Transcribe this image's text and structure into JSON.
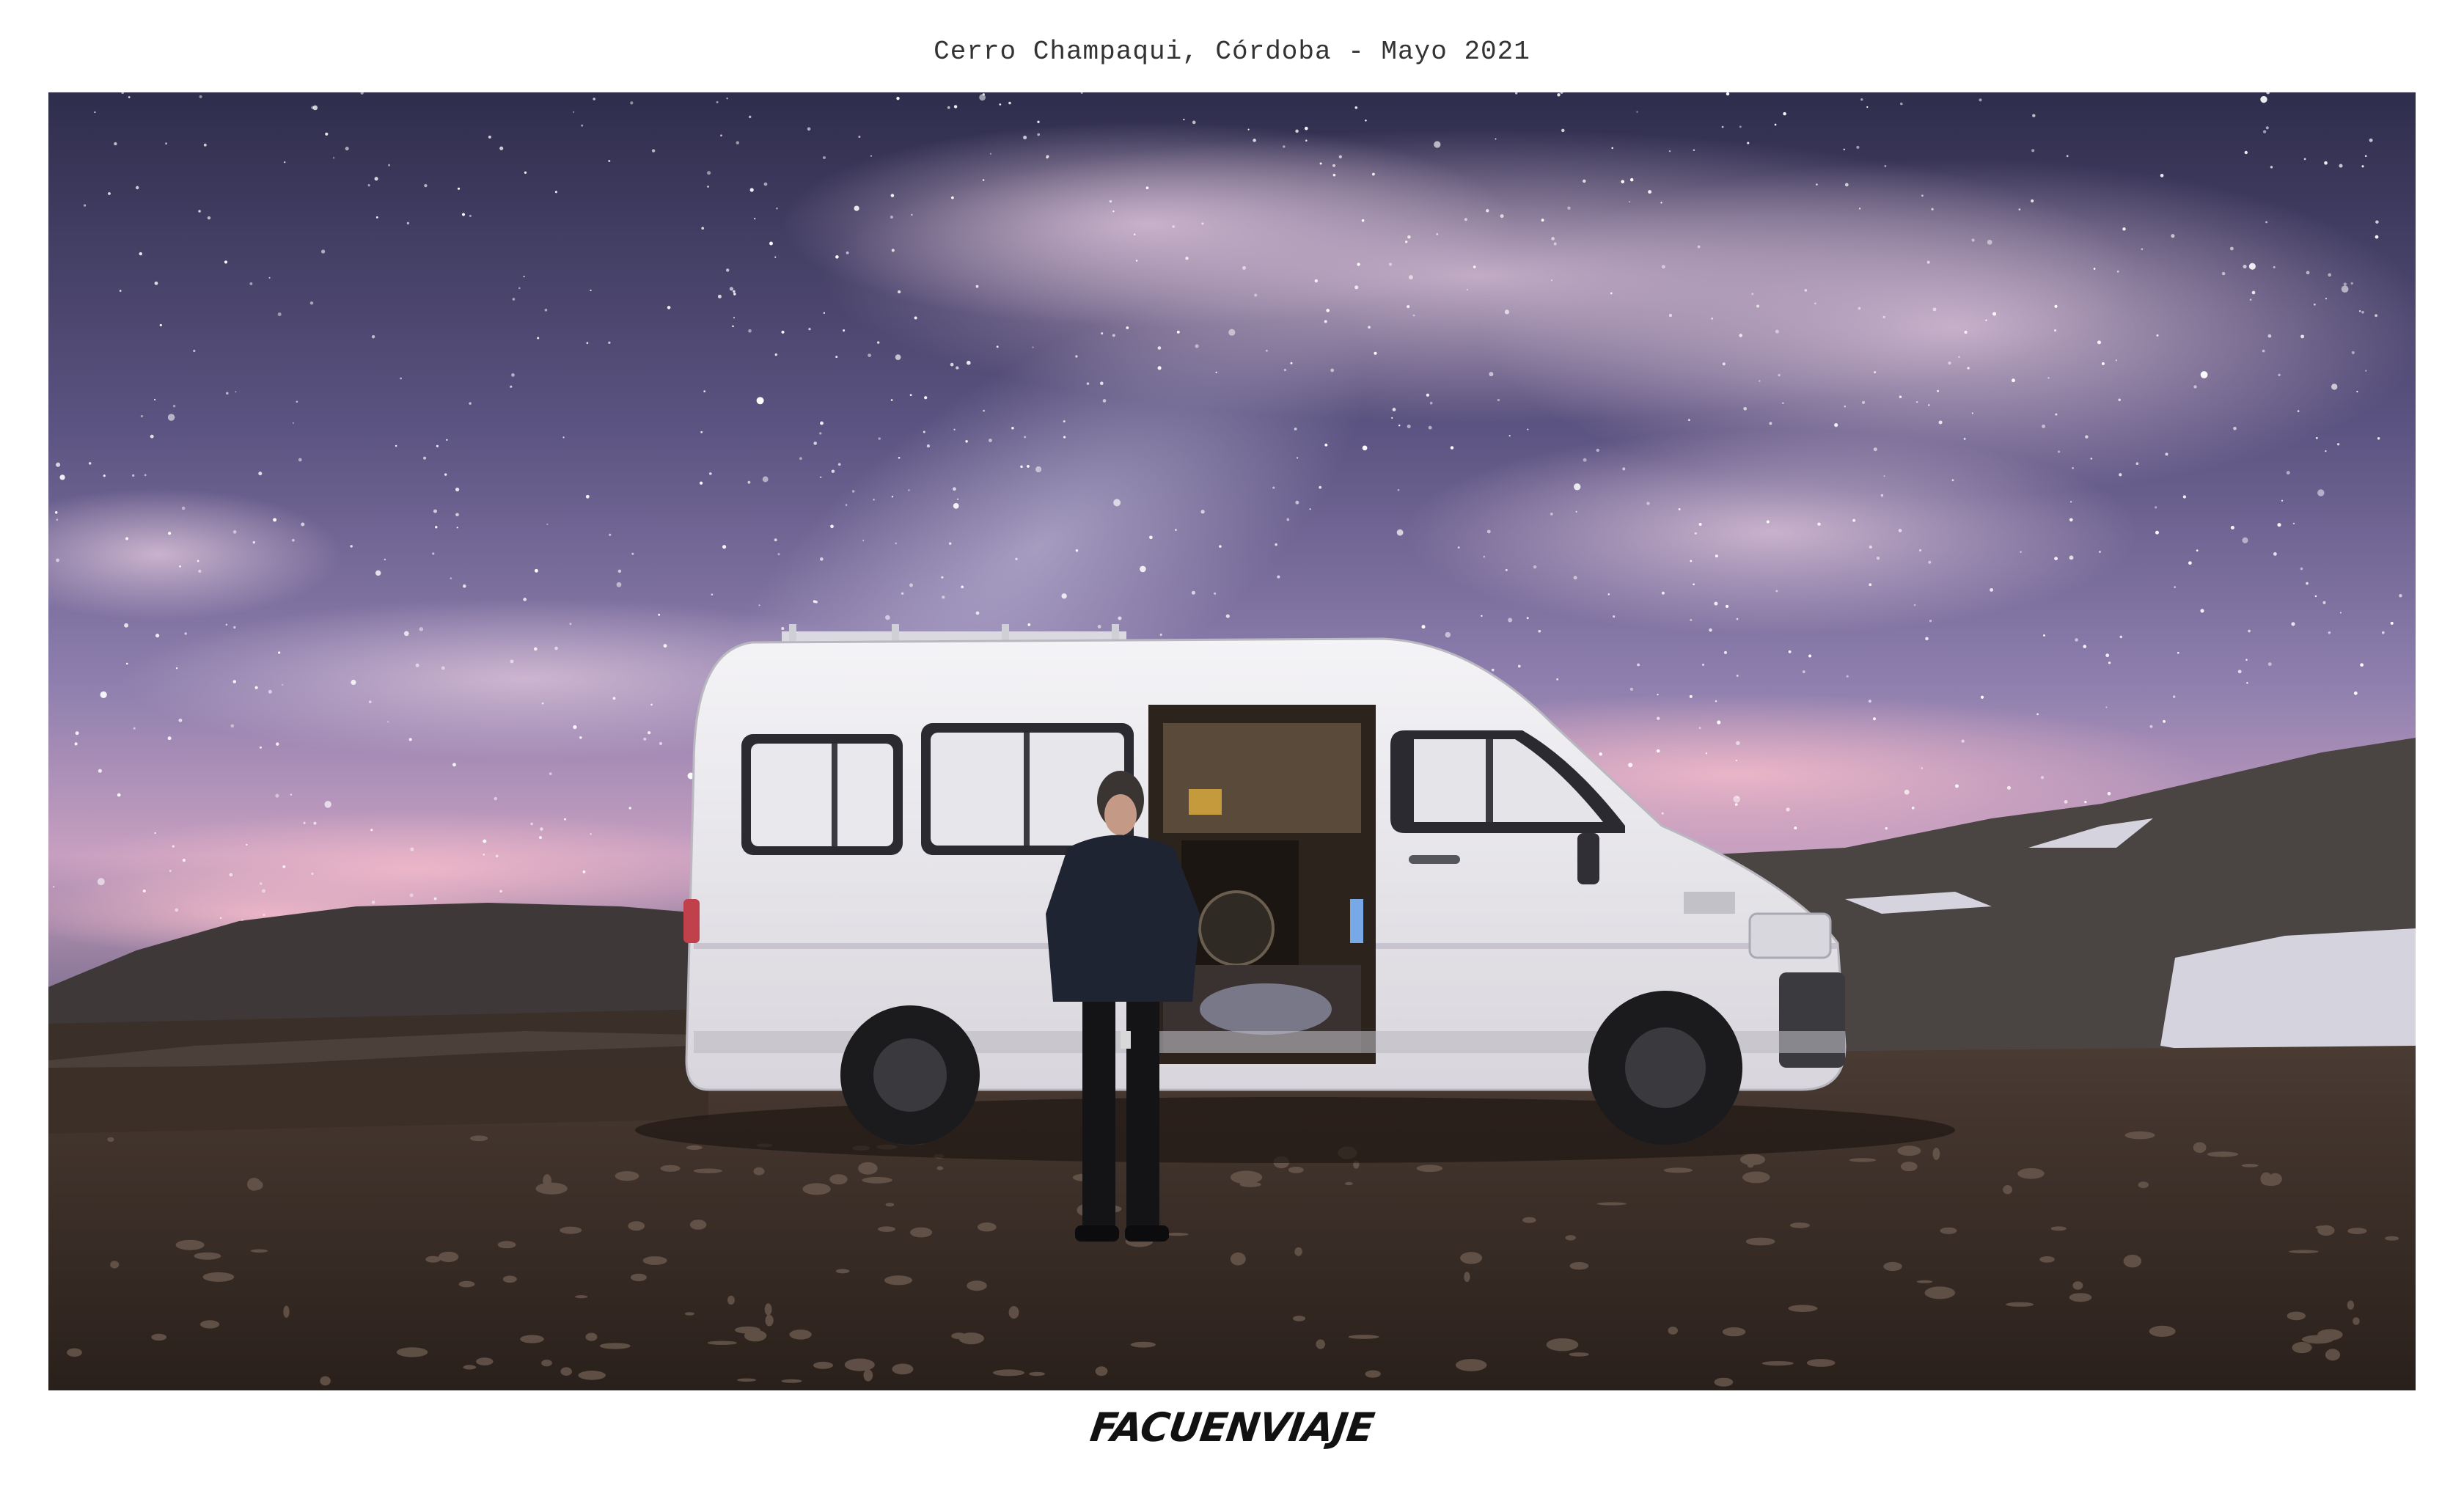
{
  "caption": "Cerro Champaqui, Córdoba - Mayo 2021",
  "brand": "FACUENVIAJE",
  "photo": {
    "subject": "white-camper-van-night-sky",
    "colors": {
      "sky_top": "#3c3a5e",
      "sky_mid": "#7b6f9c",
      "sky_horizon": "#d7a9c2",
      "ground": "#3a2e27",
      "van": "#ececf0",
      "hills": "#4a4443",
      "snow": "#e6e6f0"
    }
  }
}
